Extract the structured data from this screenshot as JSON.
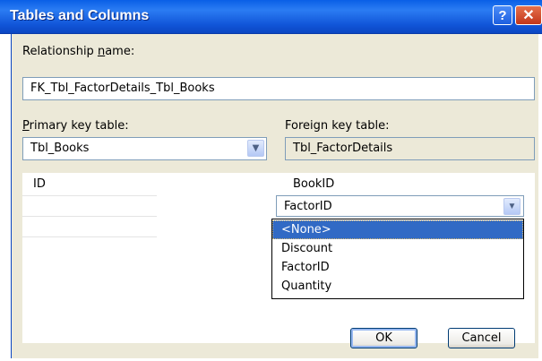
{
  "window": {
    "title": "Tables and Columns",
    "help_glyph": "?",
    "close_glyph": "✕"
  },
  "relationship": {
    "label_prefix": "Relationship ",
    "label_underlined": "n",
    "label_suffix": "ame:",
    "value": "FK_Tbl_FactorDetails_Tbl_Books"
  },
  "primary": {
    "label_underlined": "P",
    "label_suffix": "rimary key table:",
    "value": "Tbl_Books"
  },
  "foreign": {
    "label": "Foreign key table:",
    "value": "Tbl_FactorDetails"
  },
  "grid": {
    "primary_columns": [
      "ID",
      "",
      ""
    ],
    "foreign_columns": [
      "BookID",
      "FactorID"
    ]
  },
  "dropdown": {
    "options": [
      "<None>",
      "Discount",
      "FactorID",
      "Quantity"
    ],
    "selected_index": 0
  },
  "buttons": {
    "ok": "OK",
    "cancel": "Cancel"
  }
}
